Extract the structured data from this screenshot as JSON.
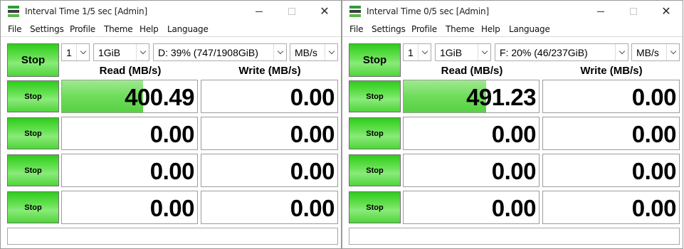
{
  "windows": [
    {
      "title": "Interval Time 1/5 sec [Admin]",
      "menu": [
        "File",
        "Settings",
        "Profile",
        "Theme",
        "Help",
        "Language"
      ],
      "stop_main": "Stop",
      "count": "1",
      "size": "1GiB",
      "drive": "D: 39% (747/1908GiB)",
      "unit": "MB/s",
      "read_header": "Read (MB/s)",
      "write_header": "Write (MB/s)",
      "rows": [
        {
          "stop": "Stop",
          "read": "400.49",
          "write": "0.00",
          "read_fill": 0.6
        },
        {
          "stop": "Stop",
          "read": "0.00",
          "write": "0.00",
          "read_fill": 0
        },
        {
          "stop": "Stop",
          "read": "0.00",
          "write": "0.00",
          "read_fill": 0
        },
        {
          "stop": "Stop",
          "read": "0.00",
          "write": "0.00",
          "read_fill": 0
        }
      ],
      "status": ""
    },
    {
      "title": "Interval Time 0/5 sec [Admin]",
      "menu": [
        "File",
        "Settings",
        "Profile",
        "Theme",
        "Help",
        "Language"
      ],
      "stop_main": "Stop",
      "count": "1",
      "size": "1GiB",
      "drive": "F: 20% (46/237GiB)",
      "unit": "MB/s",
      "read_header": "Read (MB/s)",
      "write_header": "Write (MB/s)",
      "rows": [
        {
          "stop": "Stop",
          "read": "491.23",
          "write": "0.00",
          "read_fill": 0.61
        },
        {
          "stop": "Stop",
          "read": "0.00",
          "write": "0.00",
          "read_fill": 0
        },
        {
          "stop": "Stop",
          "read": "0.00",
          "write": "0.00",
          "read_fill": 0
        },
        {
          "stop": "Stop",
          "read": "0.00",
          "write": "0.00",
          "read_fill": 0
        }
      ],
      "status": ""
    }
  ],
  "icons": {
    "app": "app-icon",
    "minimize": "minimize-icon",
    "maximize": "maximize-icon",
    "close": "close-icon",
    "dropdown": "chevron-down-icon"
  },
  "colors": {
    "button_green": "#4fd53a",
    "meter_fill": "#6fdc5c"
  }
}
